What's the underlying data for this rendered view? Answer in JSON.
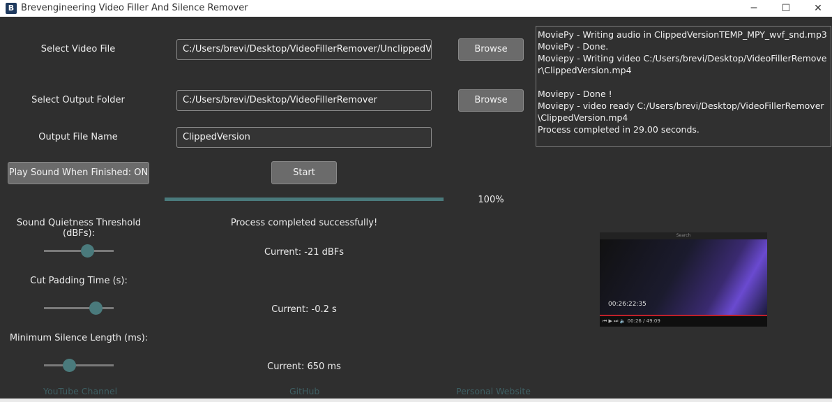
{
  "window": {
    "title": "Brevengineering Video Filler And Silence Remover",
    "icon_glyph": "B",
    "minimize_glyph": "─",
    "maximize_glyph": "☐",
    "close_glyph": "✕"
  },
  "video_file": {
    "label": "Select Video File",
    "value": "C:/Users/brevi/Desktop/VideoFillerRemover/UnclippedVideo",
    "browse_label": "Browse"
  },
  "output_folder": {
    "label": "Select Output Folder",
    "value": "C:/Users/brevi/Desktop/VideoFillerRemover",
    "browse_label": "Browse"
  },
  "output_name": {
    "label": "Output File Name",
    "value": "ClippedVersion"
  },
  "sound_toggle_label": "Play Sound When Finished: ON",
  "start_label": "Start",
  "progress": {
    "percent": 100,
    "text": "100%"
  },
  "status_text": "Process completed successfully!",
  "threshold": {
    "label": "Sound Quietness Threshold (dBFs):",
    "current": "Current: -21 dBFs",
    "level": 0.62
  },
  "padding": {
    "label": "Cut Padding Time (s):",
    "current": "Current: -0.2 s",
    "level": 0.74
  },
  "min_silence": {
    "label": "Minimum Silence Length (ms):",
    "current": "Current: 650 ms",
    "level": 0.36
  },
  "log": [
    "MoviePy - Writing audio in ClippedVersionTEMP_MPY_wvf_snd.mp3",
    "MoviePy - Done.",
    "Moviepy - Writing video C:/Users/brevi/Desktop/VideoFillerRemover\\ClippedVersion.mp4",
    "",
    "Moviepy - Done !",
    "Moviepy - video ready C:/Users/brevi/Desktop/VideoFillerRemover\\ClippedVersion.mp4",
    "Process completed in 29.00 seconds."
  ],
  "preview": {
    "search_label": "Search",
    "timestamp": "00:26:22:35",
    "controls_time": "00:26 / 49:09"
  },
  "links": {
    "youtube": "YouTube Channel",
    "github": "GitHub",
    "website": "Personal Website"
  },
  "colors": {
    "background": "#2f2f2f",
    "accent": "#4a7a7c",
    "button": "#6b6b6b"
  }
}
